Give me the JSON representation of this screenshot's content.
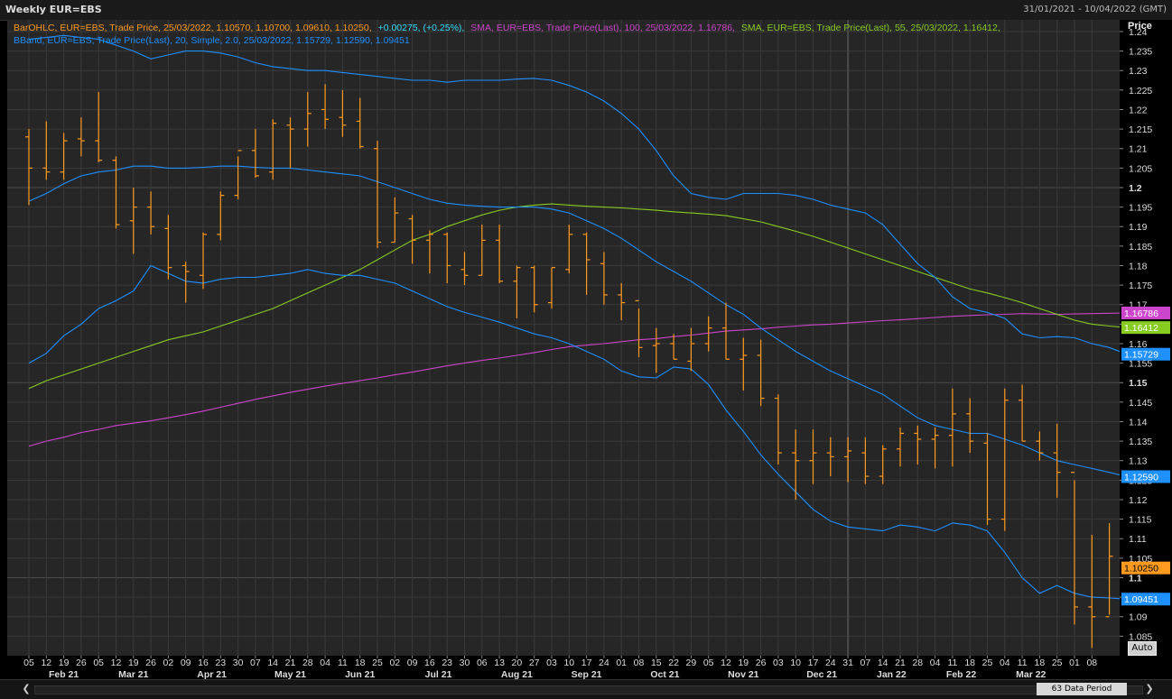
{
  "window": {
    "title": "Weekly EUR=EBS",
    "date_range": "31/01/2021 - 10/04/2022 (GMT)",
    "axis_title": "Price",
    "auto_label": "Auto",
    "period_label": "63 Data Period",
    "scroll_left_glyph": "❮",
    "scroll_right_glyph": "❯"
  },
  "legend": {
    "ohlc": "BarOHLC, EUR=EBS, Trade Price, 25/03/2022, 1.10570, 1.10700, 1.09610, 1.10250,",
    "ohlc_change": "+0.00275, (+0.25%),",
    "sma100": "SMA, EUR=EBS, Trade Price(Last), 100, 25/03/2022, 1.16786,",
    "sma55": "SMA, EUR=EBS, Trade Price(Last), 55, 25/03/2022, 1.16412,",
    "bband": "BBand, EUR=EBS, Trade Price(Last), 20, Simple, 2.0, 25/03/2022, 1.15729, 1.12590, 1.09451"
  },
  "colors": {
    "background": "#000000",
    "plot_bg": "#262626",
    "grid": "#3a3a3a",
    "grid_major": "#4a4a4a",
    "ohlc": "#ff9a1f",
    "sma100": "#cc44cc",
    "sma55": "#88cc22",
    "bband": "#1e90ff",
    "change": "#33ddff",
    "axis_text": "#dddddd"
  },
  "chart_data": {
    "type": "ohlc",
    "title": "Weekly EUR=EBS",
    "ylabel": "Price",
    "ylim": [
      1.08,
      1.243
    ],
    "y_ticks": [
      "1.24",
      "1.235",
      "1.23",
      "1.225",
      "1.22",
      "1.215",
      "1.21",
      "1.205",
      "1.2",
      "1.195",
      "1.19",
      "1.185",
      "1.18",
      "1.175",
      "1.17",
      "1.165",
      "1.16",
      "1.155",
      "1.15",
      "1.145",
      "1.14",
      "1.135",
      "1.13",
      "1.125",
      "1.12",
      "1.115",
      "1.11",
      "1.105",
      "1.1",
      "1.095",
      "1.09",
      "1.085"
    ],
    "y_ticks_bold": [
      "1.2",
      "1.15",
      "1.1"
    ],
    "x_day_ticks": [
      "05",
      "12",
      "19",
      "26",
      "05",
      "12",
      "19",
      "26",
      "02",
      "09",
      "16",
      "23",
      "30",
      "07",
      "14",
      "21",
      "28",
      "04",
      "11",
      "18",
      "25",
      "02",
      "09",
      "16",
      "23",
      "30",
      "06",
      "13",
      "20",
      "27",
      "03",
      "10",
      "17",
      "24",
      "01",
      "08",
      "15",
      "22",
      "29",
      "05",
      "12",
      "19",
      "26",
      "03",
      "10",
      "17",
      "24",
      "31",
      "07",
      "14",
      "21",
      "28",
      "04",
      "11",
      "18",
      "25",
      "04",
      "11",
      "18",
      "25",
      "01",
      "08"
    ],
    "x_month_ticks": [
      {
        "label": "Feb 21",
        "index": 2
      },
      {
        "label": "Mar 21",
        "index": 6
      },
      {
        "label": "Apr 21",
        "index": 10.5
      },
      {
        "label": "May 21",
        "index": 15
      },
      {
        "label": "Jun 21",
        "index": 19
      },
      {
        "label": "Jul 21",
        "index": 23.5
      },
      {
        "label": "Aug 21",
        "index": 28
      },
      {
        "label": "Sep 21",
        "index": 32
      },
      {
        "label": "Oct 21",
        "index": 36.5
      },
      {
        "label": "Nov 21",
        "index": 41
      },
      {
        "label": "Dec 21",
        "index": 45.5
      },
      {
        "label": "Jan 22",
        "index": 49.5
      },
      {
        "label": "Feb 22",
        "index": 53.5
      },
      {
        "label": "Mar 22",
        "index": 57.5
      }
    ],
    "ohlc": [
      [
        1.213,
        1.215,
        1.1955,
        1.205
      ],
      [
        1.205,
        1.217,
        1.202,
        1.204
      ],
      [
        1.204,
        1.214,
        1.202,
        1.212
      ],
      [
        1.2125,
        1.218,
        1.208,
        1.212
      ],
      [
        1.212,
        1.2245,
        1.2065,
        1.207
      ],
      [
        1.207,
        1.208,
        1.1895,
        1.1905
      ],
      [
        1.1915,
        1.2,
        1.183,
        1.195
      ],
      [
        1.195,
        1.199,
        1.188,
        1.19
      ],
      [
        1.1895,
        1.193,
        1.1765,
        1.1795
      ],
      [
        1.18,
        1.181,
        1.1705,
        1.1785
      ],
      [
        1.1775,
        1.1885,
        1.174,
        1.188
      ],
      [
        1.188,
        1.199,
        1.1865,
        1.198
      ],
      [
        1.198,
        1.208,
        1.197,
        1.2095
      ],
      [
        1.2095,
        1.215,
        1.2025,
        1.203
      ],
      [
        1.204,
        1.2175,
        1.202,
        1.2165
      ],
      [
        1.216,
        1.218,
        1.205,
        1.215
      ],
      [
        1.215,
        1.2245,
        1.2105,
        1.219
      ],
      [
        1.22,
        1.2265,
        1.215,
        1.2175
      ],
      [
        1.218,
        1.225,
        1.213,
        1.216
      ],
      [
        1.217,
        1.223,
        1.21,
        1.2105
      ],
      [
        1.21,
        1.212,
        1.1845,
        1.186
      ],
      [
        1.186,
        1.1975,
        1.186,
        1.1935
      ],
      [
        1.192,
        1.193,
        1.1805,
        1.1865
      ],
      [
        1.1865,
        1.189,
        1.178,
        1.188
      ],
      [
        1.188,
        1.1885,
        1.1755,
        1.18
      ],
      [
        1.179,
        1.1835,
        1.175,
        1.1775
      ],
      [
        1.1775,
        1.1905,
        1.1775,
        1.1865
      ],
      [
        1.1865,
        1.1905,
        1.1755,
        1.176
      ],
      [
        1.176,
        1.18,
        1.1665,
        1.1795
      ],
      [
        1.1795,
        1.18,
        1.168,
        1.17
      ],
      [
        1.1705,
        1.1795,
        1.169,
        1.1795
      ],
      [
        1.179,
        1.1905,
        1.178,
        1.188
      ],
      [
        1.188,
        1.1885,
        1.1725,
        1.1815
      ],
      [
        1.1805,
        1.1835,
        1.17,
        1.1725
      ],
      [
        1.1725,
        1.1755,
        1.166,
        1.1705
      ],
      [
        1.171,
        1.169,
        1.1565,
        1.159
      ],
      [
        1.1595,
        1.164,
        1.1525,
        1.16
      ],
      [
        1.16,
        1.1625,
        1.156,
        1.156
      ],
      [
        1.1555,
        1.164,
        1.153,
        1.16
      ],
      [
        1.16,
        1.167,
        1.158,
        1.164
      ],
      [
        1.164,
        1.1705,
        1.156,
        1.156
      ],
      [
        1.156,
        1.1615,
        1.148,
        1.157
      ],
      [
        1.157,
        1.161,
        1.144,
        1.146
      ],
      [
        1.146,
        1.147,
        1.129,
        1.132
      ],
      [
        1.132,
        1.138,
        1.12,
        1.13
      ],
      [
        1.13,
        1.138,
        1.124,
        1.132
      ],
      [
        1.132,
        1.136,
        1.126,
        1.131
      ],
      [
        1.131,
        1.136,
        1.1245,
        1.1325
      ],
      [
        1.132,
        1.136,
        1.124,
        1.126
      ],
      [
        1.126,
        1.134,
        1.124,
        1.133
      ],
      [
        1.133,
        1.1385,
        1.1285,
        1.137
      ],
      [
        1.137,
        1.139,
        1.129,
        1.1355
      ],
      [
        1.1355,
        1.1385,
        1.128,
        1.1365
      ],
      [
        1.1365,
        1.1485,
        1.1285,
        1.142
      ],
      [
        1.142,
        1.146,
        1.132,
        1.135
      ],
      [
        1.1345,
        1.137,
        1.1135,
        1.115
      ],
      [
        1.115,
        1.1485,
        1.112,
        1.1455
      ],
      [
        1.1455,
        1.1495,
        1.135,
        1.135
      ],
      [
        1.135,
        1.1375,
        1.13,
        1.132
      ],
      [
        1.132,
        1.1395,
        1.1205,
        1.127
      ],
      [
        1.127,
        1.125,
        1.088,
        1.0925
      ],
      [
        1.0925,
        1.111,
        1.082,
        1.09
      ],
      [
        1.09,
        1.114,
        1.0905,
        1.1055
      ],
      [
        1.1057,
        1.107,
        1.0961,
        1.1025
      ]
    ],
    "series": [
      {
        "name": "SMA 100",
        "color_key": "sma100",
        "start": 0,
        "values": [
          1.1337,
          1.135,
          1.136,
          1.1372,
          1.138,
          1.139,
          1.1396,
          1.1402,
          1.141,
          1.1418,
          1.1427,
          1.1437,
          1.1447,
          1.1457,
          1.1466,
          1.1475,
          1.1483,
          1.1491,
          1.1498,
          1.1505,
          1.1512,
          1.152,
          1.1527,
          1.1535,
          1.1543,
          1.155,
          1.1557,
          1.1563,
          1.157,
          1.1577,
          1.1585,
          1.1592,
          1.1596,
          1.16,
          1.1605,
          1.161,
          1.1613,
          1.1618,
          1.1622,
          1.1627,
          1.1632,
          1.1635,
          1.1638,
          1.1642,
          1.1645,
          1.1648,
          1.165,
          1.1653,
          1.1656,
          1.1659,
          1.1661,
          1.1664,
          1.1667,
          1.167,
          1.1672,
          1.1674,
          1.1675,
          1.1677,
          1.1676,
          1.1675,
          1.1676,
          1.1677,
          1.1678,
          1.16786
        ]
      },
      {
        "name": "SMA 55",
        "color_key": "sma55",
        "start": 0,
        "values": [
          1.1485,
          1.1505,
          1.152,
          1.1535,
          1.155,
          1.1565,
          1.158,
          1.1595,
          1.161,
          1.162,
          1.163,
          1.1645,
          1.166,
          1.1675,
          1.169,
          1.171,
          1.173,
          1.175,
          1.177,
          1.179,
          1.1815,
          1.184,
          1.1865,
          1.188,
          1.19,
          1.1915,
          1.193,
          1.1942,
          1.195,
          1.1955,
          1.1958,
          1.1955,
          1.1952,
          1.195,
          1.1948,
          1.1945,
          1.1942,
          1.1938,
          1.1935,
          1.1932,
          1.1928,
          1.192,
          1.1912,
          1.19,
          1.1888,
          1.1875,
          1.186,
          1.1845,
          1.183,
          1.1815,
          1.18,
          1.1785,
          1.177,
          1.1755,
          1.174,
          1.173,
          1.1718,
          1.1705,
          1.169,
          1.1675,
          1.166,
          1.165,
          1.1645,
          1.16412
        ]
      },
      {
        "name": "BBand Upper",
        "color_key": "bband",
        "start": 0,
        "values": [
          1.238,
          1.2385,
          1.239,
          1.2385,
          1.238,
          1.2365,
          1.235,
          1.233,
          1.234,
          1.235,
          1.235,
          1.2345,
          1.2335,
          1.232,
          1.231,
          1.2305,
          1.23,
          1.23,
          1.2295,
          1.229,
          1.2285,
          1.228,
          1.2275,
          1.2275,
          1.227,
          1.2275,
          1.2275,
          1.2275,
          1.2278,
          1.228,
          1.2275,
          1.2262,
          1.2245,
          1.2222,
          1.219,
          1.215,
          1.2095,
          1.203,
          1.1985,
          1.1975,
          1.197,
          1.1985,
          1.1985,
          1.1985,
          1.198,
          1.197,
          1.1955,
          1.1945,
          1.1935,
          1.1905,
          1.1855,
          1.1805,
          1.177,
          1.172,
          1.169,
          1.168,
          1.1665,
          1.1625,
          1.1615,
          1.1618,
          1.1615,
          1.16,
          1.159,
          1.15729
        ]
      },
      {
        "name": "BBand Middle",
        "color_key": "bband",
        "start": 0,
        "values": [
          1.1965,
          1.1985,
          1.201,
          1.203,
          1.204,
          1.2045,
          1.2055,
          1.2055,
          1.205,
          1.205,
          1.2052,
          1.2055,
          1.2055,
          1.2052,
          1.205,
          1.205,
          1.2045,
          1.204,
          1.2035,
          1.203,
          1.2015,
          1.2,
          1.1985,
          1.197,
          1.196,
          1.1955,
          1.1952,
          1.195,
          1.195,
          1.195,
          1.1945,
          1.1935,
          1.1915,
          1.1895,
          1.187,
          1.184,
          1.181,
          1.1785,
          1.176,
          1.173,
          1.17,
          1.1675,
          1.164,
          1.161,
          1.158,
          1.1555,
          1.153,
          1.151,
          1.149,
          1.147,
          1.144,
          1.141,
          1.139,
          1.138,
          1.137,
          1.137,
          1.1355,
          1.134,
          1.132,
          1.13,
          1.129,
          1.128,
          1.127,
          1.1259
        ]
      },
      {
        "name": "BBand Lower",
        "color_key": "bband",
        "start": 0,
        "values": [
          1.155,
          1.1575,
          1.162,
          1.165,
          1.169,
          1.171,
          1.1735,
          1.18,
          1.178,
          1.176,
          1.1755,
          1.1765,
          1.177,
          1.177,
          1.1775,
          1.178,
          1.179,
          1.178,
          1.1775,
          1.1775,
          1.1765,
          1.1755,
          1.1735,
          1.1715,
          1.1695,
          1.168,
          1.1668,
          1.1655,
          1.164,
          1.1625,
          1.1615,
          1.16,
          1.158,
          1.156,
          1.153,
          1.1515,
          1.1512,
          1.154,
          1.1535,
          1.1495,
          1.143,
          1.1375,
          1.1315,
          1.1265,
          1.122,
          1.1175,
          1.1145,
          1.113,
          1.1125,
          1.112,
          1.1135,
          1.113,
          1.112,
          1.114,
          1.1135,
          1.112,
          1.1065,
          1.1,
          1.096,
          1.098,
          1.096,
          1.095,
          1.0948,
          1.09451
        ]
      }
    ],
    "current_labels": [
      {
        "text": "1.16786",
        "value": 1.16786,
        "color_key": "sma100",
        "text_color": "#ffffff"
      },
      {
        "text": "1.16412",
        "value": 1.16412,
        "color_key": "sma55",
        "text_color": "#ffffff"
      },
      {
        "text": "1.15729",
        "value": 1.15729,
        "color_key": "bband",
        "text_color": "#ffffff"
      },
      {
        "text": "1.12590",
        "value": 1.1259,
        "color_key": "bband",
        "text_color": "#ffffff"
      },
      {
        "text": "1.10250",
        "value": 1.1025,
        "color_key": "ohlc",
        "text_color": "#000000"
      },
      {
        "text": "1.09451",
        "value": 1.09451,
        "color_key": "bband",
        "text_color": "#ffffff"
      }
    ],
    "grid": true
  }
}
